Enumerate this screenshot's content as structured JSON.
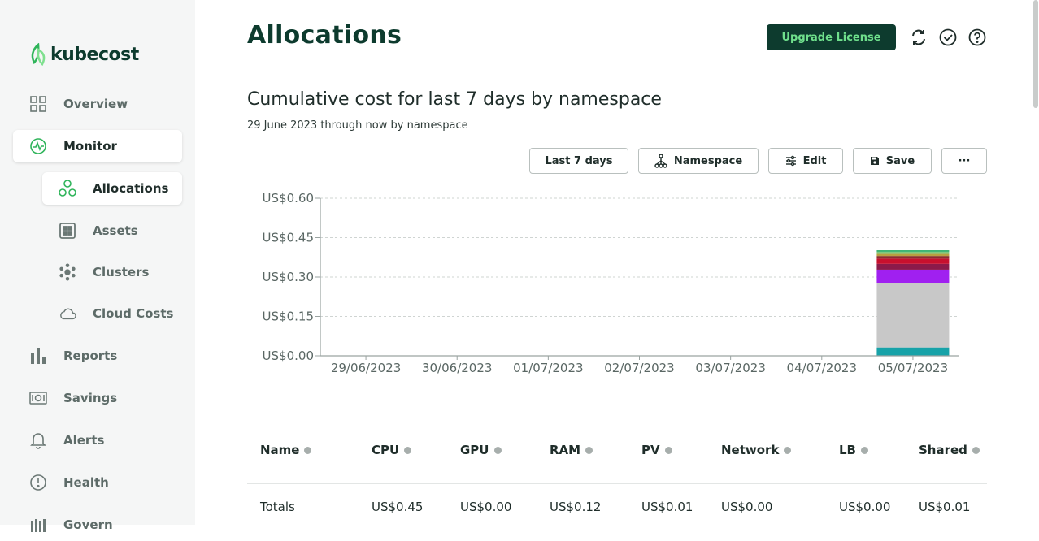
{
  "brand": {
    "name": "kubecost"
  },
  "sidebar": {
    "items": [
      {
        "label": "Overview",
        "icon": "grid-icon"
      },
      {
        "label": "Monitor",
        "icon": "monitor-pulse-icon"
      },
      {
        "label": "Allocations",
        "icon": "allocations-icon"
      },
      {
        "label": "Assets",
        "icon": "assets-icon"
      },
      {
        "label": "Clusters",
        "icon": "clusters-icon"
      },
      {
        "label": "Cloud Costs",
        "icon": "cloud-icon"
      },
      {
        "label": "Reports",
        "icon": "bar-chart-icon"
      },
      {
        "label": "Savings",
        "icon": "savings-icon"
      },
      {
        "label": "Alerts",
        "icon": "bell-icon"
      },
      {
        "label": "Health",
        "icon": "alert-circle-icon"
      },
      {
        "label": "Govern",
        "icon": "govern-icon"
      }
    ]
  },
  "header": {
    "title": "Allocations",
    "upgrade_label": "Upgrade License"
  },
  "report": {
    "title": "Cumulative cost for last 7 days by namespace",
    "subtitle": "29 June 2023 through now by namespace"
  },
  "toolbar": {
    "window_label": "Last 7 days",
    "aggregate_label": "Namespace",
    "edit_label": "Edit",
    "save_label": "Save",
    "more_label": "···"
  },
  "chart_data": {
    "type": "bar",
    "stacked": true,
    "categories": [
      "29/06/2023",
      "30/06/2023",
      "01/07/2023",
      "02/07/2023",
      "03/07/2023",
      "04/07/2023",
      "05/07/2023"
    ],
    "y_ticks": [
      "US$0.00",
      "US$0.15",
      "US$0.30",
      "US$0.45",
      "US$0.60"
    ],
    "ylim": [
      0,
      0.6
    ],
    "grid": true,
    "series": [
      {
        "color": "#17a2a8",
        "values": [
          0,
          0,
          0,
          0,
          0,
          0,
          0.032
        ]
      },
      {
        "color": "#c8c8c8",
        "values": [
          0,
          0,
          0,
          0,
          0,
          0,
          0.244
        ]
      },
      {
        "color": "#a020f0",
        "values": [
          0,
          0,
          0,
          0,
          0,
          0,
          0.052
        ]
      },
      {
        "color": "#8b1a4a",
        "values": [
          0,
          0,
          0,
          0,
          0,
          0,
          0.022
        ]
      },
      {
        "color": "#c8102e",
        "values": [
          0,
          0,
          0,
          0,
          0,
          0,
          0.02
        ]
      },
      {
        "color": "#8b2e2e",
        "values": [
          0,
          0,
          0,
          0,
          0,
          0,
          0.01
        ]
      },
      {
        "color": "#b8a040",
        "values": [
          0,
          0,
          0,
          0,
          0,
          0,
          0.008
        ]
      },
      {
        "color": "#7fc97f",
        "values": [
          0,
          0,
          0,
          0,
          0,
          0,
          0.008
        ]
      },
      {
        "color": "#3cb371",
        "values": [
          0,
          0,
          0,
          0,
          0,
          0,
          0.006
        ]
      }
    ]
  },
  "table": {
    "headers": [
      "Name",
      "CPU",
      "GPU",
      "RAM",
      "PV",
      "Network",
      "LB",
      "Shared"
    ],
    "totals": [
      "Totals",
      "US$0.45",
      "US$0.00",
      "US$0.12",
      "US$0.01",
      "US$0.00",
      "US$0.00",
      "US$0.01"
    ]
  }
}
